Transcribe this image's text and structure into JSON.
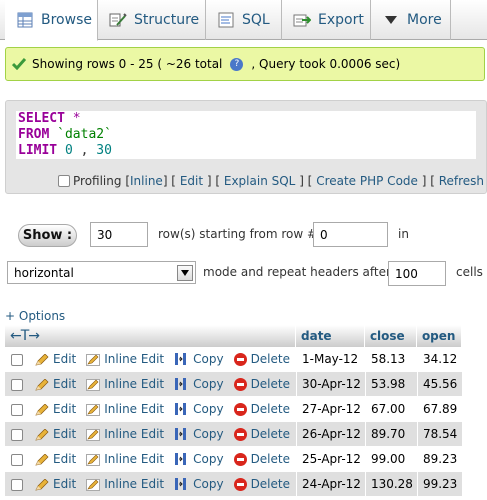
{
  "tabs": [
    {
      "label": "Browse",
      "icon": "browse-icon",
      "active": true
    },
    {
      "label": "Structure",
      "icon": "structure-icon"
    },
    {
      "label": "SQL",
      "icon": "sql-icon"
    },
    {
      "label": "Export",
      "icon": "export-icon"
    },
    {
      "label": "More",
      "icon": "dropdown-arrow-icon"
    }
  ],
  "message": {
    "before_help": "Showing rows 0 - 25 ( ~26 total",
    "help_glyph": "?",
    "after_help": ", Query took 0.0006 sec)"
  },
  "sql": {
    "select_kw": "SELECT",
    "star": " *",
    "from_kw": "FROM",
    "table": " `data2`",
    "limit_kw": "LIMIT",
    "offset": " 0",
    "comma": " ,",
    "count": " 30"
  },
  "sql_links": {
    "profiling": "Profiling",
    "inline": "Inline",
    "edit": "Edit",
    "explain": "Explain SQL",
    "create_php": "Create PHP Code",
    "refresh": "Refresh"
  },
  "nav": {
    "show_label": "Show :",
    "rows_value": "30",
    "rows_text": "row(s) starting from row #",
    "start_value": "0",
    "in_text": "in",
    "mode_value": "horizontal",
    "mode_text": "mode and repeat headers after",
    "repeat_value": "100",
    "cells_text": "cells"
  },
  "options_label": "+ Options",
  "table": {
    "col_arrows": "←T→",
    "columns": [
      "date",
      "close",
      "open"
    ],
    "action_labels": {
      "edit": "Edit",
      "inline_edit": "Inline Edit",
      "copy": "Copy",
      "delete": "Delete"
    },
    "rows": [
      [
        "1-May-12",
        "58.13",
        "34.12"
      ],
      [
        "30-Apr-12",
        "53.98",
        "45.56"
      ],
      [
        "27-Apr-12",
        "67.00",
        "67.89"
      ],
      [
        "26-Apr-12",
        "89.70",
        "78.54"
      ],
      [
        "25-Apr-12",
        "99.00",
        "89.23"
      ],
      [
        "24-Apr-12",
        "130.28",
        "99.23"
      ]
    ]
  },
  "colors": {
    "accent": "#235a81",
    "success_bg": "#ebf8a4",
    "keyword": "#990099",
    "delete": "#d9261c"
  }
}
